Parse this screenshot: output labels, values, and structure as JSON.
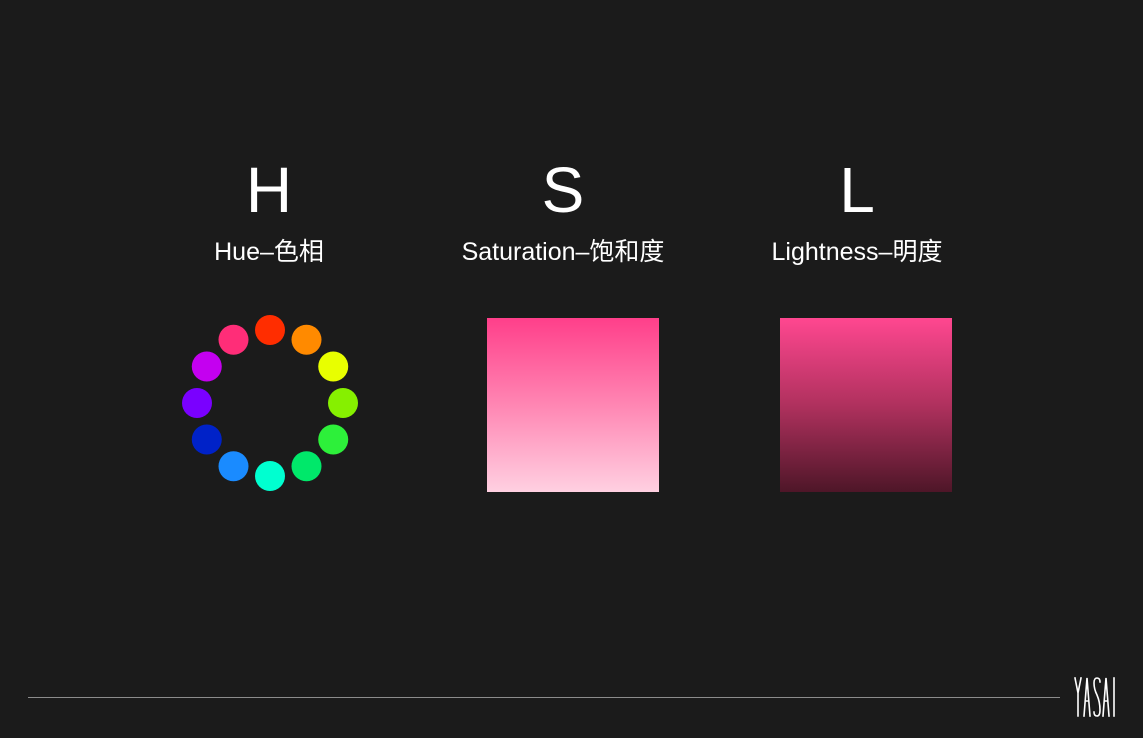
{
  "columns": [
    {
      "letter": "H",
      "label": "Hue–色相"
    },
    {
      "letter": "S",
      "label": "Saturation–饱和度"
    },
    {
      "letter": "L",
      "label": "Lightness–明度"
    }
  ],
  "hue_wheel": {
    "colors": [
      "#ff2d00",
      "#ff8a00",
      "#e8ff00",
      "#86f000",
      "#2df03a",
      "#00e86a",
      "#00ffd0",
      "#1a8bff",
      "#0022c8",
      "#7a00ff",
      "#c400f0",
      "#ff2d78"
    ]
  },
  "saturation_swatch": {
    "stops": [
      "#ff3f8a",
      "#ff86b3",
      "#ffd0e1"
    ]
  },
  "lightness_swatch": {
    "stops": [
      "#ff4790",
      "#b0315e",
      "#4e1628"
    ]
  },
  "colors": {
    "background": "#1b1b1b",
    "text": "#ffffff",
    "rule": "#8c8c8c"
  },
  "logo": {
    "text": "YASAI"
  }
}
